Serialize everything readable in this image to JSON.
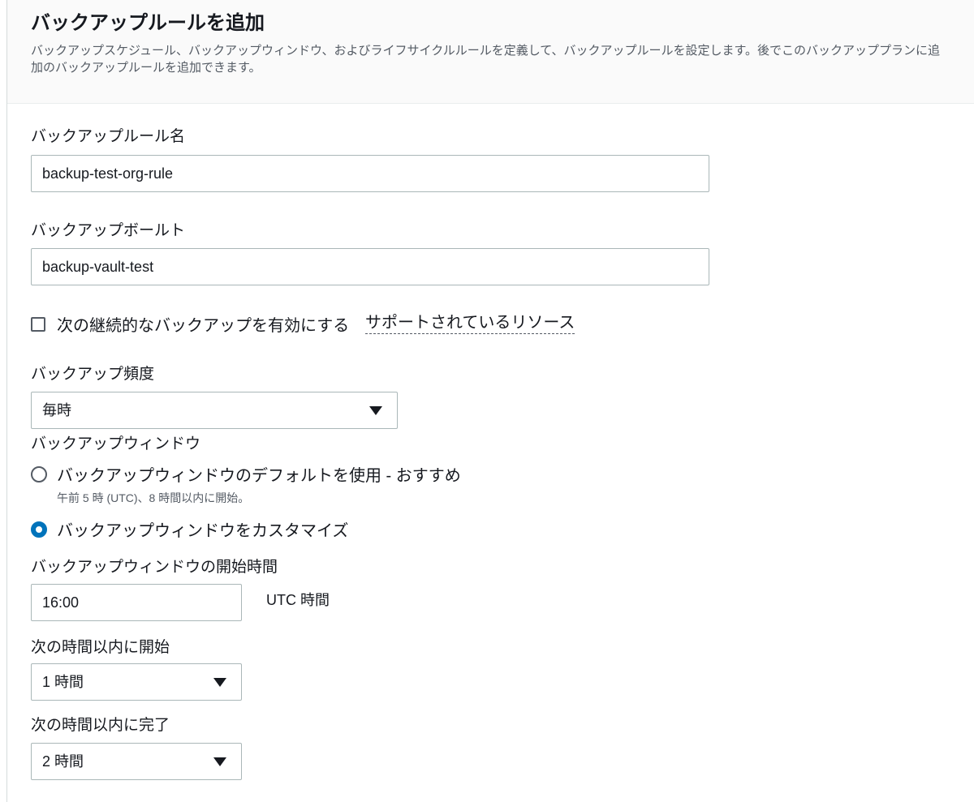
{
  "header": {
    "title": "バックアップルールを追加",
    "description": "バックアップスケジュール、バックアップウィンドウ、およびライフサイクルルールを定義して、バックアップルールを設定します。後でこのバックアッププランに追加のバックアップルールを追加できます。"
  },
  "rule_name": {
    "label": "バックアップルール名",
    "value": "backup-test-org-rule"
  },
  "vault": {
    "label": "バックアップボールト",
    "value": "backup-vault-test"
  },
  "continuous": {
    "label": "次の継続的なバックアップを有効にする",
    "link": "サポートされているリソース",
    "checked": false
  },
  "frequency": {
    "label": "バックアップ頻度",
    "value": "毎時",
    "icon": "caret-down-icon"
  },
  "window": {
    "label": "バックアップウィンドウ",
    "options": [
      {
        "label": "バックアップウィンドウのデフォルトを使用 - おすすめ",
        "sub": "午前 5 時 (UTC)、8 時間以内に開始。",
        "checked": false
      },
      {
        "label": "バックアップウィンドウをカスタマイズ",
        "checked": true
      }
    ]
  },
  "start_time": {
    "label": "バックアップウィンドウの開始時間",
    "value": "16:00",
    "unit": "UTC 時間"
  },
  "start_within": {
    "label": "次の時間以内に開始",
    "value": "1 時間"
  },
  "complete_within": {
    "label": "次の時間以内に完了",
    "value": "2 時間"
  },
  "colors": {
    "accent": "#0073bb",
    "header_bg": "#fafafa",
    "border": "#aab7b8"
  }
}
